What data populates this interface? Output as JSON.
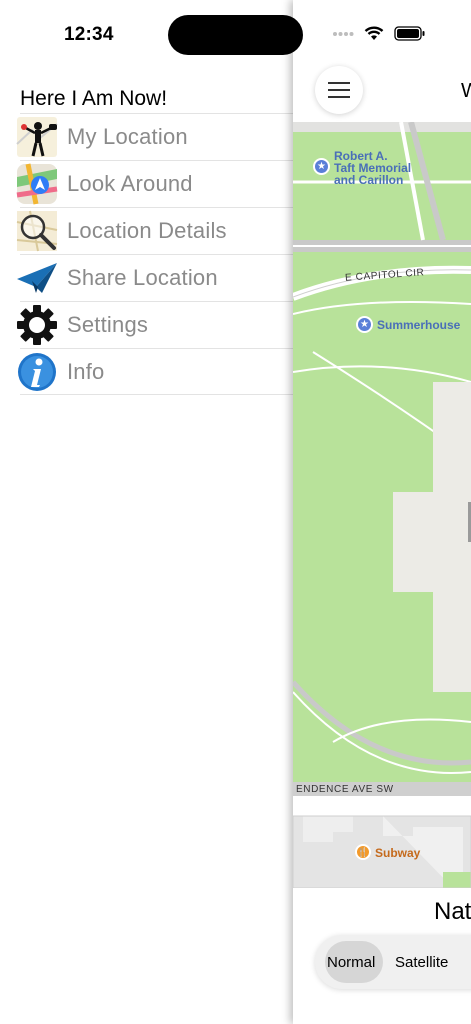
{
  "status_bar": {
    "time": "12:34"
  },
  "menu": {
    "title": "Here I Am Now!",
    "items": [
      {
        "label": "My Location",
        "icon": "person-pointing-icon"
      },
      {
        "label": "Look Around",
        "icon": "maps-app-icon"
      },
      {
        "label": "Location Details",
        "icon": "magnifier-map-icon"
      },
      {
        "label": "Share Location",
        "icon": "paper-plane-icon"
      },
      {
        "label": "Settings",
        "icon": "gear-icon"
      },
      {
        "label": "Info",
        "icon": "info-icon"
      }
    ]
  },
  "map": {
    "header_title": "W",
    "pois": [
      {
        "label": "Robert A. Taft Memorial and Carillon",
        "lines": [
          "Robert A.",
          "Taft Memorial",
          "and Carillon"
        ]
      },
      {
        "label": "Summerhouse"
      }
    ],
    "streets": [
      "E CAPITOL CIR",
      "ENDENCE AVE SW"
    ],
    "business": "Subway",
    "place_name": "Nat",
    "map_types": [
      "Normal",
      "Satellite"
    ],
    "selected_map_type": "Normal",
    "colors": {
      "park": "#b8e29a",
      "road": "#ffffff",
      "building": "#ecebe6",
      "poi": "#5a7fd8",
      "food": "#f39a2a"
    }
  }
}
